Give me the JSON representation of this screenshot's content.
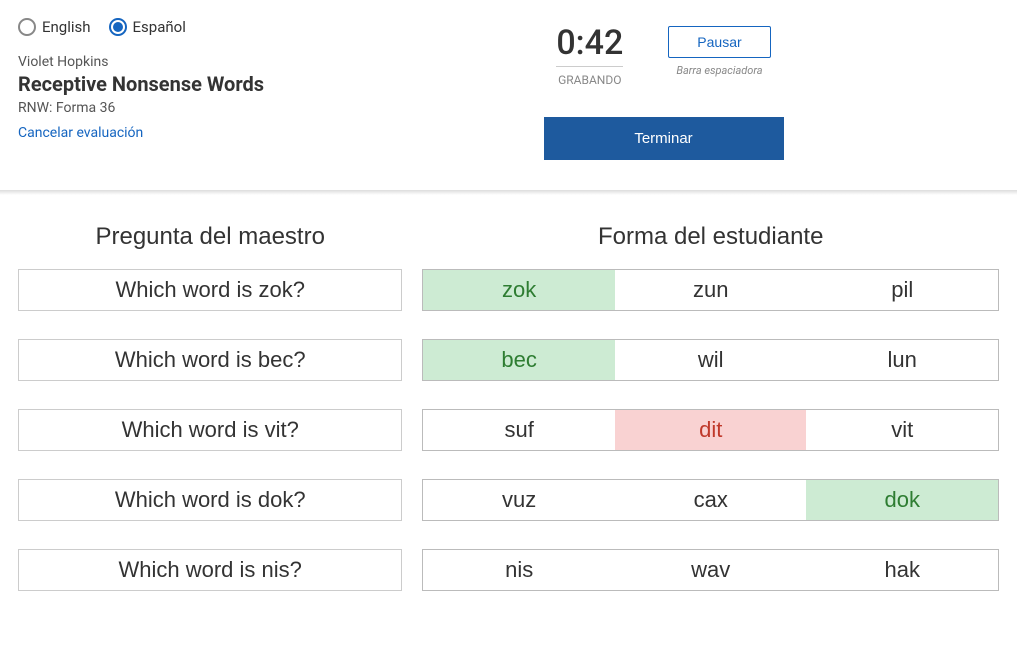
{
  "lang": {
    "en": "English",
    "es": "Español",
    "selected": "es"
  },
  "student": "Violet Hopkins",
  "title": "Receptive Nonsense Words",
  "form_id": "RNW: Forma 36",
  "cancel": "Cancelar evaluación",
  "timer": {
    "value": "0:42",
    "status": "GRABANDO"
  },
  "pause": {
    "label": "Pausar",
    "hint": "Barra espaciadora"
  },
  "finish": "Terminar",
  "headers": {
    "teacher": "Pregunta del maestro",
    "student": "Forma del estudiante"
  },
  "rows": [
    {
      "q": "Which word is zok?",
      "opts": [
        "zok",
        "zun",
        "pil"
      ],
      "mark": [
        1,
        0,
        0
      ]
    },
    {
      "q": "Which word is bec?",
      "opts": [
        "bec",
        "wil",
        "lun"
      ],
      "mark": [
        1,
        0,
        0
      ]
    },
    {
      "q": "Which word is vit?",
      "opts": [
        "suf",
        "dit",
        "vit"
      ],
      "mark": [
        0,
        -1,
        0
      ]
    },
    {
      "q": "Which word is dok?",
      "opts": [
        "vuz",
        "cax",
        "dok"
      ],
      "mark": [
        0,
        0,
        1
      ]
    },
    {
      "q": "Which word is nis?",
      "opts": [
        "nis",
        "wav",
        "hak"
      ],
      "mark": [
        0,
        0,
        0
      ]
    }
  ]
}
